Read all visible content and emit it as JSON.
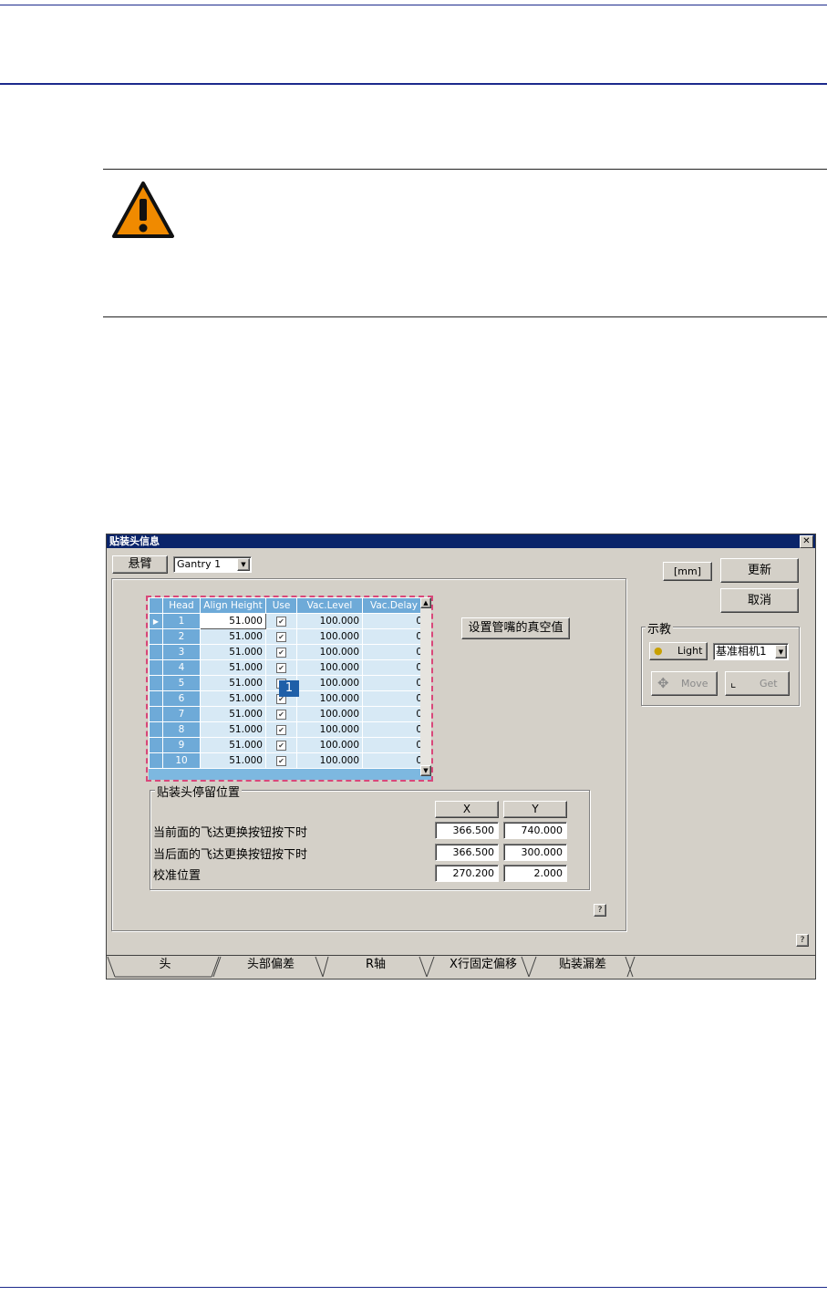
{
  "dialog": {
    "title": "贴装头信息",
    "close_label": "✕",
    "gantry_label": "悬臂",
    "gantry_value": "Gantry 1",
    "unit_label": "[mm]",
    "update_button": "更新",
    "cancel_button": "取消",
    "vacuum_button": "设置管嘴的真空值",
    "teach_group": "示教",
    "light_button": "Light",
    "camera_value": "基准相机1",
    "move_button": "Move",
    "get_button": "Get",
    "help_label": "?",
    "grid": {
      "columns": [
        "Head",
        "Align Height",
        "Use",
        "Vac.Level",
        "Vac.Delay"
      ],
      "rows": [
        {
          "head": "1",
          "align": "51.000",
          "vac": "100.000",
          "delay": "0"
        },
        {
          "head": "2",
          "align": "51.000",
          "vac": "100.000",
          "delay": "0"
        },
        {
          "head": "3",
          "align": "51.000",
          "vac": "100.000",
          "delay": "0"
        },
        {
          "head": "4",
          "align": "51.000",
          "vac": "100.000",
          "delay": "0"
        },
        {
          "head": "5",
          "align": "51.000",
          "vac": "100.000",
          "delay": "0"
        },
        {
          "head": "6",
          "align": "51.000",
          "vac": "100.000",
          "delay": "0"
        },
        {
          "head": "7",
          "align": "51.000",
          "vac": "100.000",
          "delay": "0"
        },
        {
          "head": "8",
          "align": "51.000",
          "vac": "100.000",
          "delay": "0"
        },
        {
          "head": "9",
          "align": "51.000",
          "vac": "100.000",
          "delay": "0"
        },
        {
          "head": "10",
          "align": "51.000",
          "vac": "100.000",
          "delay": "0"
        }
      ]
    },
    "callout": "1",
    "park": {
      "title": "贴装头停留位置",
      "x_header": "X",
      "y_header": "Y",
      "rows": [
        {
          "label": "当前面的飞达更换按钮按下时",
          "x": "366.500",
          "y": "740.000"
        },
        {
          "label": "当后面的飞达更换按钮按下时",
          "x": "366.500",
          "y": "300.000"
        },
        {
          "label": "校准位置",
          "x": "270.200",
          "y": "2.000"
        }
      ]
    },
    "tabs": [
      "头",
      "头部偏差",
      "R轴",
      "X行固定偏移",
      "贴装漏差"
    ]
  },
  "colors": {
    "page_rule": "#1c2a8c",
    "title_bar": "#0a246a",
    "grid_header": "#6eaad8",
    "grid_cell": "#d7e9f5",
    "highlight_dash": "#d9477a",
    "callout": "#1e5fa8",
    "warning": "#f08a00"
  }
}
